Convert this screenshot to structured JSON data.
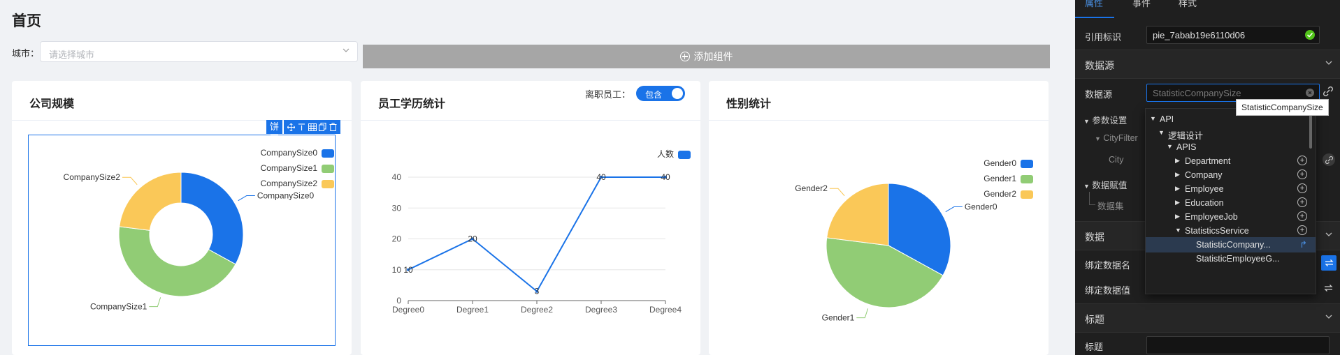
{
  "page": {
    "title": "首页"
  },
  "filter": {
    "label": "城市：",
    "placeholder": "请选择城市"
  },
  "add_component": {
    "label": "添加组件"
  },
  "cards": {
    "company": {
      "title": "公司规模"
    },
    "education": {
      "title": "员工学历统计",
      "toggle_label": "离职员工：",
      "toggle_value": "包含"
    },
    "gender": {
      "title": "性别统计"
    }
  },
  "selection_toolbar": {
    "label": "饼图",
    "icons": [
      "move-icon",
      "align-top-icon",
      "table-icon",
      "copy-icon",
      "delete-icon"
    ]
  },
  "colors": {
    "blue": "#1a73e8",
    "green": "#91cc75",
    "yellow": "#fac858",
    "accent": "#1a73e8",
    "panel_bg": "#1f1f1f",
    "ok": "#52c41a"
  },
  "chart_data": [
    {
      "type": "pie",
      "variant": "donut",
      "title": "",
      "categories": [
        "CompanySize0",
        "CompanySize1",
        "CompanySize2"
      ],
      "values": [
        33,
        44,
        23
      ],
      "legend": [
        "CompanySize0",
        "CompanySize1",
        "CompanySize2"
      ],
      "legend_position": "top-right",
      "slice_labels": [
        "CompanySize0",
        "CompanySize1",
        "CompanySize2"
      ]
    },
    {
      "type": "line",
      "title": "",
      "categories": [
        "Degree0",
        "Degree1",
        "Degree2",
        "Degree3",
        "Degree4"
      ],
      "series": [
        {
          "name": "人数",
          "values": [
            10,
            20,
            3,
            40,
            40
          ]
        }
      ],
      "point_labels": [
        "10",
        "20",
        "3",
        "40",
        "40"
      ],
      "yticks": [
        "0",
        "10",
        "20",
        "30",
        "40"
      ],
      "ylim": [
        0,
        40
      ],
      "legend_position": "top-right",
      "grid": true
    },
    {
      "type": "pie",
      "title": "",
      "categories": [
        "Gender0",
        "Gender1",
        "Gender2"
      ],
      "values": [
        33,
        44,
        23
      ],
      "legend": [
        "Gender0",
        "Gender1",
        "Gender2"
      ],
      "legend_position": "top-right",
      "slice_labels": [
        "Gender0",
        "Gender1",
        "Gender2"
      ]
    }
  ],
  "panel": {
    "tabs": [
      "属性",
      "事件",
      "样式"
    ],
    "ref_label": "引用标识",
    "ref_value": "pie_7abab19e6110d06",
    "sections": {
      "datasource": "数据源",
      "data": "数据",
      "title": "标题"
    },
    "datasource_label": "数据源",
    "datasource_value": "StatisticCompanySize",
    "tooltip": "StatisticCompanySize",
    "param_settings": "参数设置",
    "city_filter": "CityFilter",
    "city": "City",
    "data_assign": "数据赋值",
    "dataset": "数据集",
    "bind_name": "绑定数据名",
    "bind_value": "绑定数据值",
    "title_label": "标题",
    "tree": [
      {
        "label": "API",
        "level": 0,
        "expanded": true
      },
      {
        "label": "逻辑设计",
        "level": 1,
        "expanded": true
      },
      {
        "label": "APIS",
        "level": 2,
        "expanded": true
      },
      {
        "label": "Department",
        "level": 3,
        "expanded": false,
        "addable": true
      },
      {
        "label": "Company",
        "level": 3,
        "expanded": false,
        "addable": true
      },
      {
        "label": "Employee",
        "level": 3,
        "expanded": false,
        "addable": true
      },
      {
        "label": "Education",
        "level": 3,
        "expanded": false,
        "addable": true
      },
      {
        "label": "EmployeeJob",
        "level": 3,
        "expanded": false,
        "addable": true
      },
      {
        "label": "StatisticsService",
        "level": 3,
        "expanded": true,
        "addable": true
      },
      {
        "label": "StatisticCompany...",
        "level": 4,
        "selected": true
      },
      {
        "label": "StatisticEmployeeG...",
        "level": 4
      }
    ]
  }
}
